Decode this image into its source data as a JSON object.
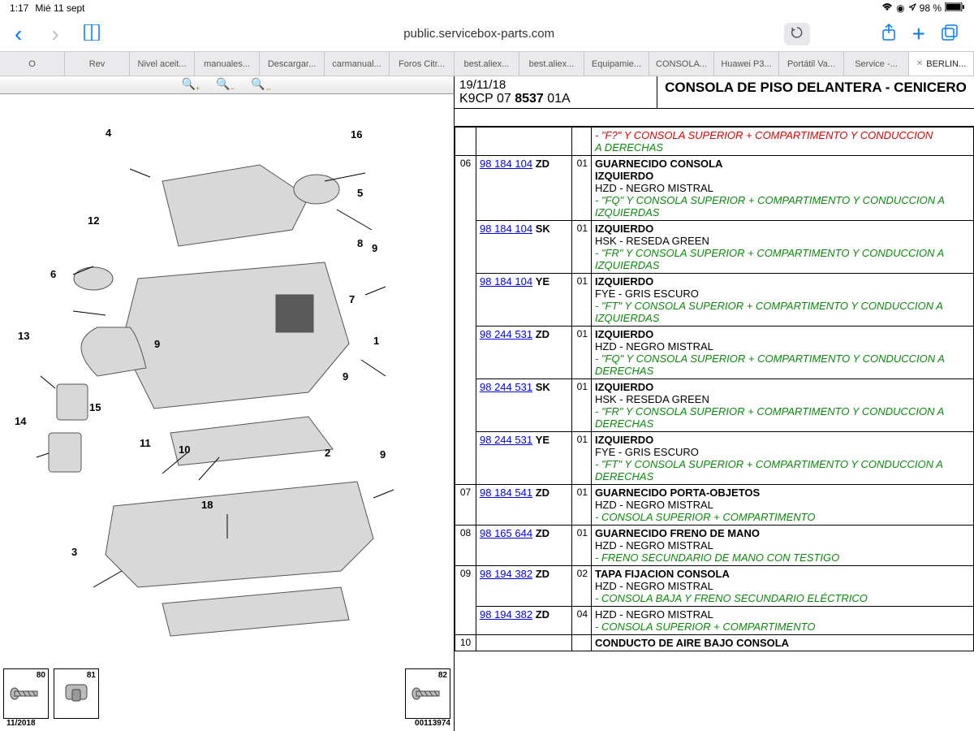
{
  "status": {
    "time": "1:17",
    "date": "Mié 11 sept",
    "battery": "98 %",
    "wifi": "wifi-icon",
    "lock": "lock-icon",
    "location": "location-icon"
  },
  "browser": {
    "url": "public.servicebox-parts.com",
    "tabs": [
      "O",
      "Rev",
      "Nivel aceit...",
      "manuales...",
      "Descargar...",
      "carmanual...",
      "Foros Citr...",
      "best.aliex...",
      "best.aliex...",
      "Equipamie...",
      "CONSOLA...",
      "Huawei P3...",
      "Portátil Va...",
      "Service -...",
      "BERLIN..."
    ]
  },
  "header": {
    "date": "19/11/18",
    "code_prefix": "K9CP 07 ",
    "code_bold": "8537",
    "code_suffix": " 01A",
    "title": "CONSOLA DE PISO DELANTERA - CENICERO"
  },
  "diagram": {
    "callouts": [
      "1",
      "2",
      "3",
      "4",
      "5",
      "6",
      "7",
      "8",
      "9",
      "9",
      "9",
      "9",
      "10",
      "11",
      "12",
      "13",
      "14",
      "15",
      "16",
      "18"
    ],
    "insets_left": [
      "80",
      "81"
    ],
    "insets_right": [
      "82"
    ],
    "date_ref": "11/2018",
    "img_ref": "00113974"
  },
  "truncated_top": "A DERECHAS",
  "truncated_top_upper": "- \"F?\" Y CONSOLA SUPERIOR + COMPARTIMENTO Y CONDUCCION",
  "rows": [
    {
      "idx": "06",
      "title": "GUARNECIDO CONSOLA",
      "entries": [
        {
          "ref": "98 184 104",
          "suffix": "ZD",
          "qty": "01",
          "sub": "IZQUIERDO",
          "code": "HZD - NEGRO MISTRAL",
          "note": "- \"FQ\" Y CONSOLA SUPERIOR + COMPARTIMENTO Y CONDUCCION A IZQUIERDAS"
        },
        {
          "ref": "98 184 104",
          "suffix": "SK",
          "qty": "01",
          "sub": "IZQUIERDO",
          "code": "HSK - RESEDA GREEN",
          "note": "- \"FR\" Y CONSOLA SUPERIOR + COMPARTIMENTO Y CONDUCCION A IZQUIERDAS"
        },
        {
          "ref": "98 184 104",
          "suffix": "YE",
          "qty": "01",
          "sub": "IZQUIERDO",
          "code": "FYE - GRIS ESCURO",
          "note": "- \"FT\" Y CONSOLA SUPERIOR + COMPARTIMENTO Y CONDUCCION A IZQUIERDAS"
        },
        {
          "ref": "98 244 531",
          "suffix": "ZD",
          "qty": "01",
          "sub": "IZQUIERDO",
          "code": "HZD - NEGRO MISTRAL",
          "note": "- \"FQ\" Y CONSOLA SUPERIOR + COMPARTIMENTO Y CONDUCCION A DERECHAS"
        },
        {
          "ref": "98 244 531",
          "suffix": "SK",
          "qty": "01",
          "sub": "IZQUIERDO",
          "code": "HSK - RESEDA GREEN",
          "note": "- \"FR\" Y CONSOLA SUPERIOR + COMPARTIMENTO Y CONDUCCION A DERECHAS"
        },
        {
          "ref": "98 244 531",
          "suffix": "YE",
          "qty": "01",
          "sub": "IZQUIERDO",
          "code": "FYE - GRIS ESCURO",
          "note": "- \"FT\" Y CONSOLA SUPERIOR + COMPARTIMENTO Y CONDUCCION A DERECHAS"
        }
      ]
    },
    {
      "idx": "07",
      "title": "GUARNECIDO PORTA-OBJETOS",
      "entries": [
        {
          "ref": "98 184 541",
          "suffix": "ZD",
          "qty": "01",
          "sub": "",
          "code": "HZD - NEGRO MISTRAL",
          "note": "- CONSOLA SUPERIOR + COMPARTIMENTO"
        }
      ]
    },
    {
      "idx": "08",
      "title": "GUARNECIDO FRENO DE MANO",
      "entries": [
        {
          "ref": "98 165 644",
          "suffix": "ZD",
          "qty": "01",
          "sub": "",
          "code": "HZD - NEGRO MISTRAL",
          "note": "- FRENO SECUNDARIO DE MANO CON TESTIGO"
        }
      ]
    },
    {
      "idx": "09",
      "title": "TAPA FIJACION CONSOLA",
      "entries": [
        {
          "ref": "98 194 382",
          "suffix": "ZD",
          "qty": "02",
          "sub": "",
          "code": "HZD - NEGRO MISTRAL",
          "note": "- CONSOLA BAJA Y FRENO SECUNDARIO ELÉCTRICO"
        },
        {
          "ref": "98 194 382",
          "suffix": "ZD",
          "qty": "04",
          "sub": "",
          "code": "HZD - NEGRO MISTRAL",
          "note": "- CONSOLA SUPERIOR + COMPARTIMENTO"
        }
      ]
    },
    {
      "idx": "10",
      "title": "CONDUCTO DE AIRE BAJO CONSOLA",
      "entries": []
    }
  ]
}
